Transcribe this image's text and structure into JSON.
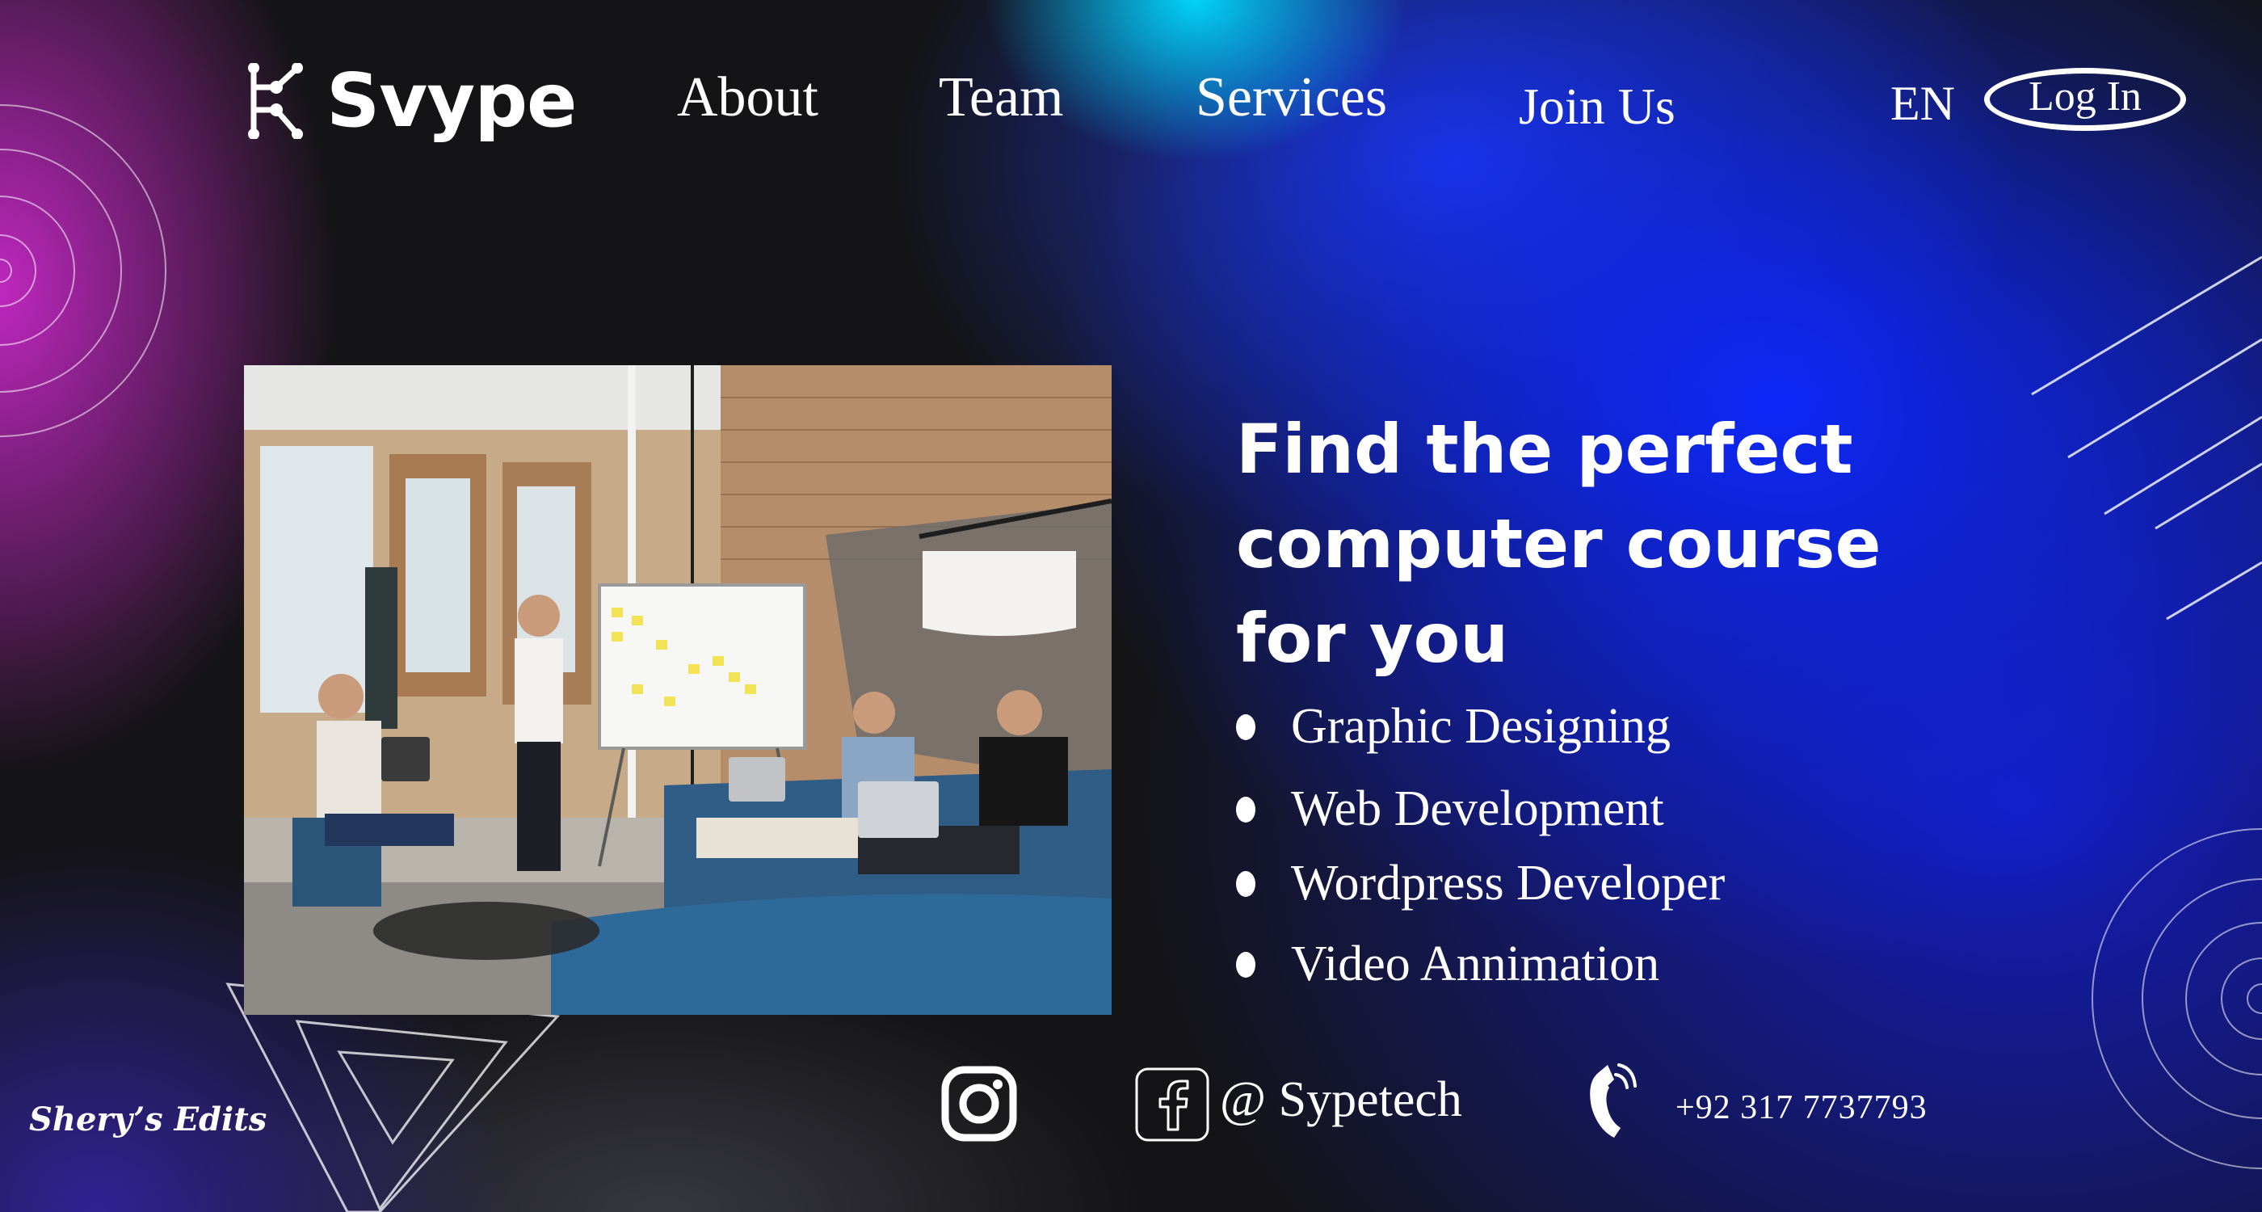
{
  "brand": {
    "name": "Svype"
  },
  "nav": {
    "about": "About",
    "team": "Team",
    "services": "Services",
    "join": "Join Us"
  },
  "header": {
    "language": "EN",
    "login": "Log In"
  },
  "hero": {
    "headline_lines": [
      "Find the perfect",
      "computer course",
      "for you"
    ],
    "courses": [
      "Graphic Designing",
      "Web Development",
      "Wordpress Developer",
      "Video Annimation"
    ]
  },
  "footer": {
    "social_handle": "@ Sypetech",
    "phone": "+92 317 7737793"
  },
  "watermark": "Shery’s Edits",
  "colors": {
    "accent_blue": "#0c28ff",
    "accent_cyan": "#00dcff",
    "accent_magenta": "#c828c8",
    "background": "#141416"
  }
}
